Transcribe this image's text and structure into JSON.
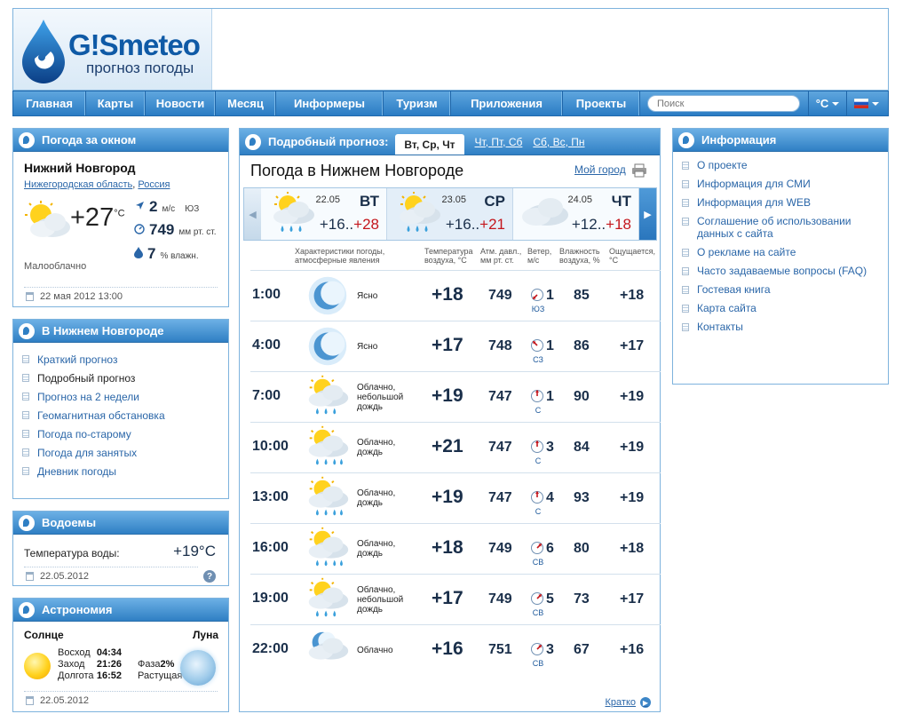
{
  "brand": {
    "logo_text": "G!Smeteo",
    "tagline": "прогноз погоды"
  },
  "nav": {
    "items": [
      {
        "label": "Главная",
        "w": 82
      },
      {
        "label": "Карты",
        "w": 67
      },
      {
        "label": "Новости",
        "w": 79
      },
      {
        "label": "Месяц",
        "w": 68
      },
      {
        "label": "Информеры",
        "w": 121
      },
      {
        "label": "Туризм",
        "w": 76
      },
      {
        "label": "Приложения",
        "w": 126
      },
      {
        "label": "Проекты",
        "w": 87
      }
    ],
    "search_placeholder": "Поиск",
    "units_label": "°C",
    "lang_flag": "russia-flag-icon"
  },
  "now": {
    "title": "Погода за окном",
    "city": "Нижний Новгород",
    "region": "Нижегородская область",
    "country": "Россия",
    "temperature": "+27",
    "temp_unit": "°C",
    "wind_speed": "2",
    "wind_unit": "м/с",
    "wind_dir": "ЮЗ",
    "pressure": "749",
    "pressure_unit": "мм рт. ст.",
    "humidity": "7",
    "humidity_unit": "% влажн.",
    "condition": "Малооблачно",
    "timestamp": "22 мая 2012 13:00"
  },
  "city_links": {
    "title": "В Нижнем Новгороде",
    "items": [
      "Краткий прогноз",
      "Подробный прогноз",
      "Прогноз на 2 недели",
      "Геомагнитная обстановка",
      "Погода по-старому",
      "Погода для занятых",
      "Дневник погоды"
    ],
    "current_index": 1
  },
  "water": {
    "title": "Водоемы",
    "label": "Температура воды:",
    "value": "+19°C",
    "date": "22.05.2012",
    "help_glyph": "?"
  },
  "astro": {
    "title": "Астрономия",
    "sun_title": "Солнце",
    "moon_title": "Луна",
    "sunrise_label": "Восход",
    "sunrise": "04:34",
    "sunset_label": "Заход",
    "sunset": "21:26",
    "daylength_label": "Долгота",
    "daylength": "16:52",
    "phase_label": "Фаза",
    "phase": "2%",
    "moon_state": "Растущая",
    "date": "22.05.2012"
  },
  "forecast": {
    "header_label": "Подробный прогноз:",
    "tabs": [
      "Вт, Ср, Чт",
      "Чт, Пт, Сб",
      "Сб, Вс, Пн"
    ],
    "title": "Погода в Нижнем Новгороде",
    "my_city": "Мой город",
    "days": [
      {
        "date": "22.05",
        "name": "ВТ",
        "low": "+16..",
        "high": "+28",
        "active": false
      },
      {
        "date": "23.05",
        "name": "СР",
        "low": "+16..",
        "high": "+21",
        "active": true
      },
      {
        "date": "24.05",
        "name": "ЧТ",
        "low": "+12..",
        "high": "+18",
        "active": false
      }
    ],
    "columns": {
      "conditions": [
        "Характеристики погоды,",
        "атмосферные явления"
      ],
      "temp": [
        "Температура",
        "воздуха, °C"
      ],
      "pressure": [
        "Атм. давл.,",
        "мм рт. ст."
      ],
      "wind": [
        "Ветер,",
        "м/с"
      ],
      "humidity": [
        "Влажность",
        "воздуха, %"
      ],
      "feels": [
        "Ощущается,",
        "°C"
      ]
    },
    "rows": [
      {
        "time": "1:00",
        "icon": "moon-clear-icon",
        "desc": [
          "Ясно"
        ],
        "temp": "+18",
        "pressure": "749",
        "wind_dir": "ЮЗ",
        "wind_speed": "1",
        "humidity": "85",
        "feels": "+18"
      },
      {
        "time": "4:00",
        "icon": "moon-clear-icon",
        "desc": [
          "Ясно"
        ],
        "temp": "+17",
        "pressure": "748",
        "wind_dir": "СЗ",
        "wind_speed": "1",
        "humidity": "86",
        "feels": "+17"
      },
      {
        "time": "7:00",
        "icon": "sun-cloud-light-rain-icon",
        "desc": [
          "Облачно,",
          "небольшой",
          "дождь"
        ],
        "temp": "+19",
        "pressure": "747",
        "wind_dir": "С",
        "wind_speed": "1",
        "humidity": "90",
        "feels": "+19"
      },
      {
        "time": "10:00",
        "icon": "sun-cloud-rain-icon",
        "desc": [
          "Облачно,",
          "дождь"
        ],
        "temp": "+21",
        "pressure": "747",
        "wind_dir": "С",
        "wind_speed": "3",
        "humidity": "84",
        "feels": "+19"
      },
      {
        "time": "13:00",
        "icon": "sun-cloud-rain-icon",
        "desc": [
          "Облачно,",
          "дождь"
        ],
        "temp": "+19",
        "pressure": "747",
        "wind_dir": "С",
        "wind_speed": "4",
        "humidity": "93",
        "feels": "+19"
      },
      {
        "time": "16:00",
        "icon": "sun-cloud-rain-icon",
        "desc": [
          "Облачно,",
          "дождь"
        ],
        "temp": "+18",
        "pressure": "749",
        "wind_dir": "СВ",
        "wind_speed": "6",
        "humidity": "80",
        "feels": "+18"
      },
      {
        "time": "19:00",
        "icon": "sun-cloud-light-rain-icon",
        "desc": [
          "Облачно,",
          "небольшой",
          "дождь"
        ],
        "temp": "+17",
        "pressure": "749",
        "wind_dir": "СВ",
        "wind_speed": "5",
        "humidity": "73",
        "feels": "+17"
      },
      {
        "time": "22:00",
        "icon": "moon-cloud-icon",
        "desc": [
          "Облачно"
        ],
        "temp": "+16",
        "pressure": "751",
        "wind_dir": "СВ",
        "wind_speed": "3",
        "humidity": "67",
        "feels": "+16"
      }
    ],
    "brief_link": "Кратко"
  },
  "info": {
    "title": "Информация",
    "items": [
      "О проекте",
      "Информация для СМИ",
      "Информация для WEB",
      "Соглашение об использовании данных с сайта",
      "О рекламе на сайте",
      "Часто задаваемые вопросы (FAQ)",
      "Гостевая книга",
      "Карта сайта",
      "Контакты"
    ]
  },
  "colors": {
    "accent": "#2f7fc4",
    "link": "#2a66a8",
    "high_temp": "#c4161c"
  }
}
